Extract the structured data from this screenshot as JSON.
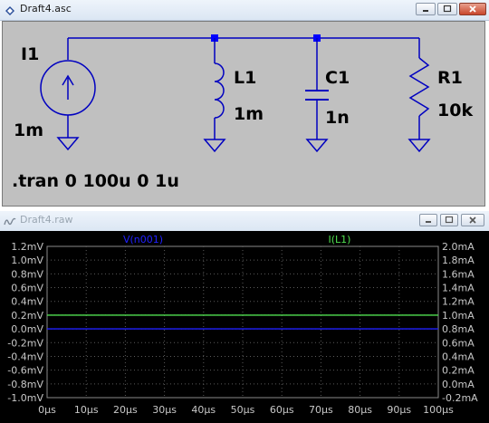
{
  "schematic_window": {
    "title": "Draft4.asc",
    "icon": "schematic-icon",
    "buttons": [
      "minimize-icon",
      "maximize-icon",
      "close-icon"
    ]
  },
  "schematic": {
    "wire_color": "#0000c0",
    "junction_color": "#0000ff",
    "components": [
      {
        "ref": "I1",
        "value": "1m",
        "kind": "current-source"
      },
      {
        "ref": "L1",
        "value": "1m",
        "kind": "inductor"
      },
      {
        "ref": "C1",
        "value": "1n",
        "kind": "capacitor"
      },
      {
        "ref": "R1",
        "value": "10k",
        "kind": "resistor"
      }
    ],
    "directive": ".tran 0 100u 0 1u"
  },
  "waveform_window": {
    "title": "Draft4.raw",
    "icon": "waveform-icon",
    "buttons": [
      "minimize-icon",
      "maximize-icon",
      "close-icon"
    ]
  },
  "chart_data": {
    "type": "line",
    "background": "#000000",
    "grid": true,
    "x": {
      "min": 0,
      "max": 100,
      "unit": "µs",
      "ticks": [
        "0µs",
        "10µs",
        "20µs",
        "30µs",
        "40µs",
        "50µs",
        "60µs",
        "70µs",
        "80µs",
        "90µs",
        "100µs"
      ]
    },
    "y_left": {
      "min": -1.0,
      "max": 1.2,
      "unit": "mV",
      "ticks": [
        "1.2mV",
        "1.0mV",
        "0.8mV",
        "0.6mV",
        "0.4mV",
        "0.2mV",
        "0.0mV",
        "-0.2mV",
        "-0.4mV",
        "-0.6mV",
        "-0.8mV",
        "-1.0mV"
      ]
    },
    "y_right": {
      "min": -0.2,
      "max": 2.0,
      "unit": "mA",
      "ticks": [
        "2.0mA",
        "1.8mA",
        "1.6mA",
        "1.4mA",
        "1.2mA",
        "1.0mA",
        "0.8mA",
        "0.6mA",
        "0.4mA",
        "0.2mA",
        "0.0mA",
        "-0.2mA"
      ]
    },
    "series": [
      {
        "name": "V(n001)",
        "axis": "left",
        "color": "#2020ff",
        "x": [
          0,
          100
        ],
        "y": [
          0.0,
          0.0
        ]
      },
      {
        "name": "I(L1)",
        "axis": "right",
        "color": "#50e050",
        "x": [
          0,
          100
        ],
        "y": [
          1.0,
          1.0
        ]
      }
    ]
  }
}
